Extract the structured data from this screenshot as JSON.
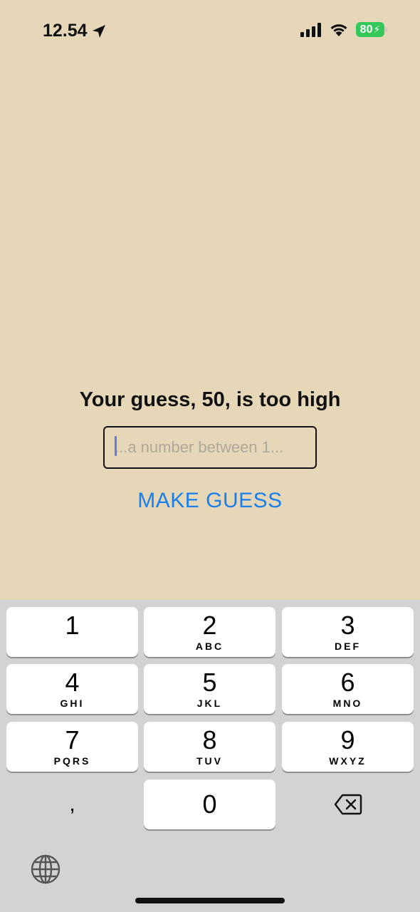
{
  "status_bar": {
    "time": "12.54",
    "battery": "80"
  },
  "game": {
    "feedback": "Your guess, 50, is too high",
    "input_value": "",
    "input_placeholder": "...a number between 1...",
    "button_label": "MAKE GUESS"
  },
  "keyboard": {
    "keys": [
      {
        "digit": "1",
        "letters": ""
      },
      {
        "digit": "2",
        "letters": "ABC"
      },
      {
        "digit": "3",
        "letters": "DEF"
      },
      {
        "digit": "4",
        "letters": "GHI"
      },
      {
        "digit": "5",
        "letters": "JKL"
      },
      {
        "digit": "6",
        "letters": "MNO"
      },
      {
        "digit": "7",
        "letters": "PQRS"
      },
      {
        "digit": "8",
        "letters": "TUV"
      },
      {
        "digit": "9",
        "letters": "WXYZ"
      },
      {
        "digit": ",",
        "letters": ""
      },
      {
        "digit": "0",
        "letters": ""
      }
    ]
  },
  "colors": {
    "background": "#e5d7b8",
    "accent": "#1a7fea",
    "battery": "#34c759",
    "keyboard": "#d3d3d3"
  }
}
